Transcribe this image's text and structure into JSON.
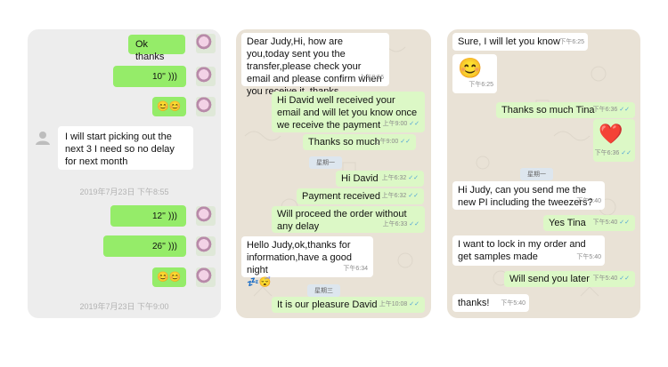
{
  "panel1": {
    "msg_ok_thanks": "Ok thanks",
    "voice1": "10''",
    "emoji1": "😊😊",
    "msg_left": "I will start picking out the next 3 I need so no delay for next month",
    "time1": "2019年7月23日 下午8:55",
    "voice2": "12''",
    "voice3": "26''",
    "emoji2": "😊😊",
    "time2": "2019年7月23日 下午9:00"
  },
  "panel2": {
    "m1": "Dear Judy,Hi, how are you,today sent you the transfer,please check your email and please confirm when you receive it, thanks",
    "m1_time": "上午8:56",
    "m2": "Hi David well received your email and will let you know once we receive the payment",
    "m2_time": "上午9:00",
    "m3": "Thanks so much",
    "m3_time": "上午9:00",
    "day1": "星期一",
    "m4": "Hi David",
    "m4_time": "上午6:32",
    "m5": "Payment received",
    "m5_time": "上午6:32",
    "m6": "Will proceed the order without any delay",
    "m6_time": "上午6:33",
    "m7": "Hello Judy,ok,thanks for information,have a good night",
    "m7_emoji": "💤😴",
    "m7_time": "下午6:34",
    "day2": "星期三",
    "m8": "It is our pleasure David",
    "m8_time": "上午10:08"
  },
  "panel3": {
    "m1": "Sure, I will let you know",
    "m1_time": "下午6:25",
    "smiley": "😊",
    "smiley_time": "下午6:25",
    "m2": "Thanks so much Tina",
    "m2_time": "下午6:36",
    "heart": "❤️",
    "heart_time": "下午6:36",
    "day1": "星期一",
    "m3": "Hi Judy, can you send me the new PI including the tweezers?",
    "m3_time": "下午5:40",
    "m4": "Yes Tina",
    "m4_time": "下午5:40",
    "m5": "I want to lock in my order and get samples made",
    "m5_time": "下午5:40",
    "m6": "Will send you later",
    "m6_time": "下午5:40",
    "m7": "thanks!",
    "m7_time": "下午5:40"
  },
  "ticks": "✓✓",
  "colors": {
    "wechat_green": "#95ec69",
    "whatsapp_green": "#dcf8c6",
    "whatsapp_bg": "#e9e2d6",
    "wechat_bg": "#ededed"
  }
}
